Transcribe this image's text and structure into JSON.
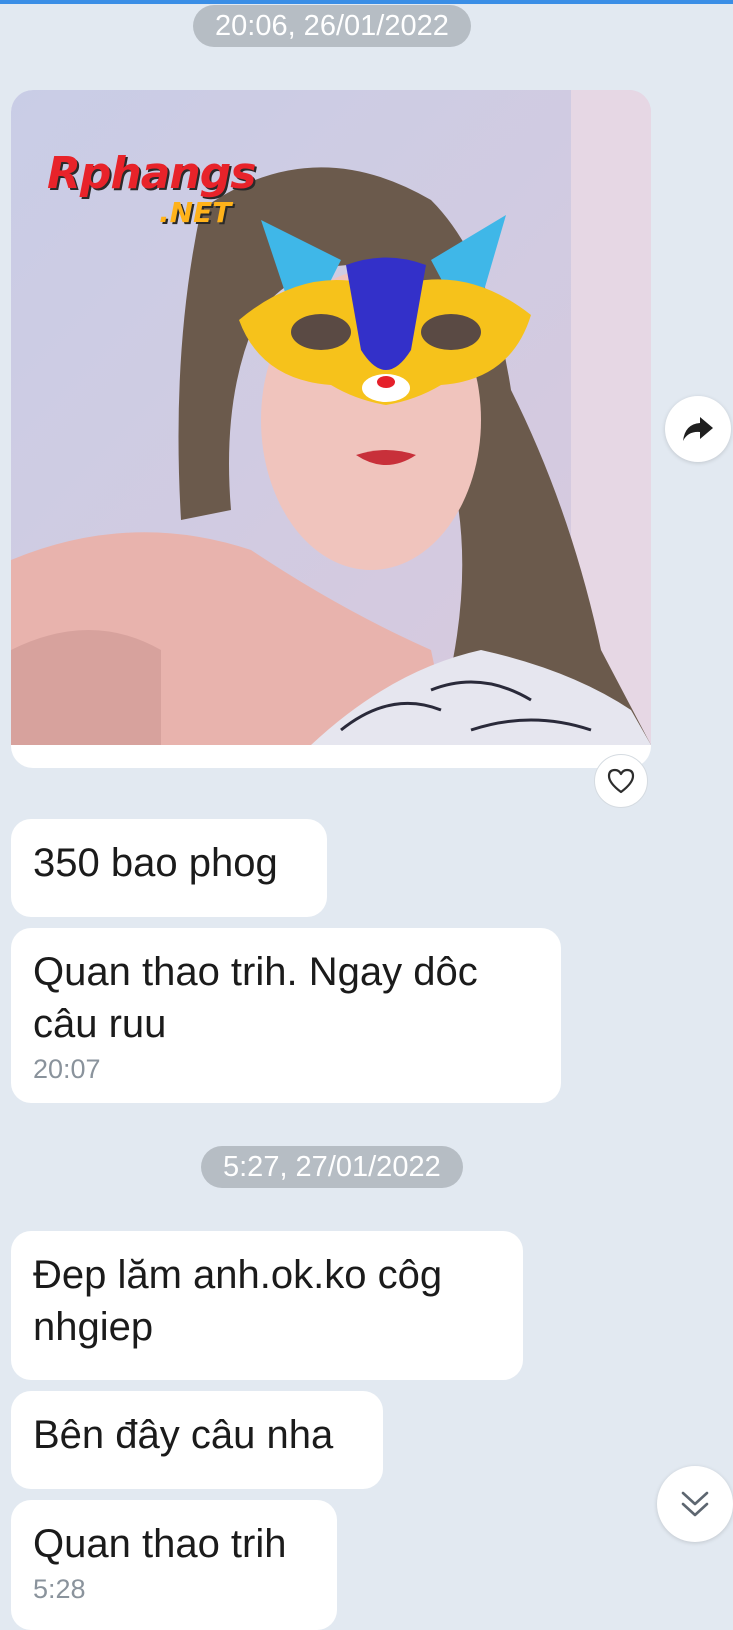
{
  "colors": {
    "background": "#e2e9f1",
    "bubble": "#ffffff",
    "date_pill": "#b6bdc4",
    "timestamp": "#8a939c",
    "accent": "#3a8ee6"
  },
  "dates": [
    "20:06, 26/01/2022",
    "5:27, 27/01/2022"
  ],
  "watermark": {
    "brand": "Rphangs",
    "suffix": ".NET"
  },
  "photo_message": {
    "icon_share": "share-arrow-icon",
    "icon_react": "heart-icon"
  },
  "messages": [
    {
      "text": "350 bao phog"
    },
    {
      "text": "Quan thao trih. Ngay dôc câu ruu",
      "time": "20:07"
    },
    {
      "text": "Đep lăm anh.ok.ko côg nhgiep"
    },
    {
      "text": "Bên đây câu nha"
    },
    {
      "text": "Quan thao trih",
      "time": "5:28"
    }
  ],
  "scroll_button": {
    "icon": "double-chevron-down-icon"
  }
}
